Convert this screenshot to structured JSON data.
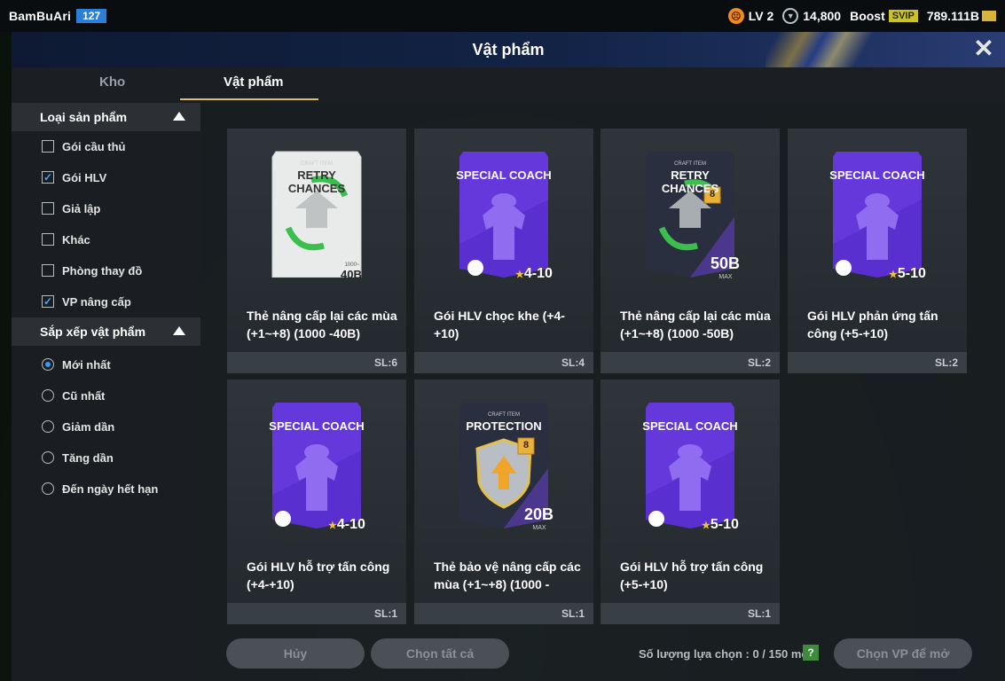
{
  "topbar": {
    "player_name": "BamBuAri",
    "player_level": "127",
    "lv_label": "LV 2",
    "coins": "14,800",
    "boost_label": "Boost",
    "svip_label": "SVIP",
    "balance": "789.111B"
  },
  "modal": {
    "title": "Vật phẩm",
    "close_glyph": "✕"
  },
  "tabs": [
    {
      "label": "Kho",
      "active": false
    },
    {
      "label": "Vật phẩm",
      "active": true
    }
  ],
  "sidebar": {
    "product_type_header": "Loại sản phẩm",
    "product_types": [
      {
        "label": "Gói cầu thủ",
        "checked": false
      },
      {
        "label": "Gói HLV",
        "checked": true
      },
      {
        "label": "Giả lập",
        "checked": false
      },
      {
        "label": "Khác",
        "checked": false
      },
      {
        "label": "Phòng thay đồ",
        "checked": false
      },
      {
        "label": "VP nâng cấp",
        "checked": true
      }
    ],
    "sort_header": "Sắp xếp vật phẩm",
    "sort_options": [
      {
        "label": "Mới nhất",
        "selected": true
      },
      {
        "label": "Cũ nhất",
        "selected": false
      },
      {
        "label": "Giảm dần",
        "selected": false
      },
      {
        "label": "Tăng dần",
        "selected": false
      },
      {
        "label": "Đến ngày hết hạn",
        "selected": false
      }
    ]
  },
  "items": [
    {
      "kind": "retry-white",
      "art_sub": "CRAFT ITEM",
      "art_title": "RETRY CHANCES",
      "value": "40B",
      "value_sub": "1000~",
      "title": "Thẻ nâng cấp lại các mùa (+1~+8) (1000 -40B)",
      "count": "SL:6"
    },
    {
      "kind": "coach",
      "art_title": "SPECIAL COACH",
      "rating": "4-10",
      "title": "Gói HLV chọc khe (+4-+10)",
      "count": "SL:4"
    },
    {
      "kind": "retry-dark",
      "art_sub": "CRAFT ITEM",
      "art_title": "RETRY CHANCES",
      "value": "50B",
      "value_sub": "MAX",
      "level": "8",
      "title": "Thẻ nâng cấp lại các mùa (+1~+8) (1000 -50B)",
      "count": "SL:2"
    },
    {
      "kind": "coach",
      "art_title": "SPECIAL COACH",
      "rating": "5-10",
      "title": "Gói HLV phản ứng tấn công (+5-+10)",
      "count": "SL:2"
    },
    {
      "kind": "coach",
      "art_title": "SPECIAL COACH",
      "rating": "4-10",
      "title": "Gói HLV hỗ trợ tấn công (+4-+10)",
      "count": "SL:1"
    },
    {
      "kind": "protection",
      "art_sub": "CRAFT ITEM",
      "art_title": "PROTECTION",
      "value": "20B",
      "value_sub": "MAX",
      "level": "8",
      "title": "Thẻ bảo vệ nâng cấp các mùa (+1~+8) (1000 -",
      "count": "SL:1"
    },
    {
      "kind": "coach",
      "art_title": "SPECIAL COACH",
      "rating": "5-10",
      "title": "Gói HLV hỗ trợ tấn công (+5-+10)",
      "count": "SL:1"
    }
  ],
  "footer": {
    "cancel_label": "Hủy",
    "select_all_label": "Chọn tất cả",
    "selection_count": "Số lượng lựa chọn : 0 / 150 món",
    "help_glyph": "?",
    "open_label": "Chọn VP để mở"
  },
  "colors": {
    "accent_underline": "#d9c071",
    "checkbox_blue": "#4aa3ff",
    "coach_purple": "#5a2fd0",
    "level_badge": "#2a7fd8"
  },
  "icons": {
    "lv": "face-icon",
    "coins": "shield-coin-icon",
    "balance": "gold-bar-icon"
  }
}
